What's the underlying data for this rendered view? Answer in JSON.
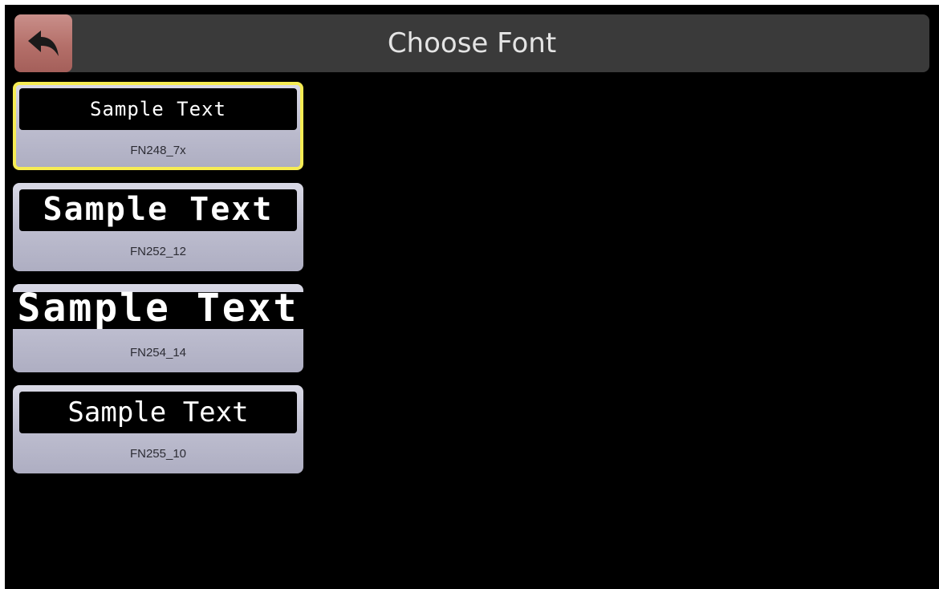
{
  "header": {
    "title": "Choose Font",
    "back_icon": "back-arrow-icon"
  },
  "fonts": [
    {
      "sample": "Sample Text",
      "name": "FN248_7x",
      "selected": true
    },
    {
      "sample": "Sample Text",
      "name": "FN252_12",
      "selected": false
    },
    {
      "sample": "Sample Text",
      "name": "FN254_14",
      "selected": false
    },
    {
      "sample": "Sample Text",
      "name": "FN255_10",
      "selected": false
    }
  ],
  "colors": {
    "background": "#000000",
    "header_bg": "#3a3a3a",
    "back_button": "#b46f69",
    "card_bg": "#bcbcce",
    "selected_border": "#f6ec54"
  }
}
